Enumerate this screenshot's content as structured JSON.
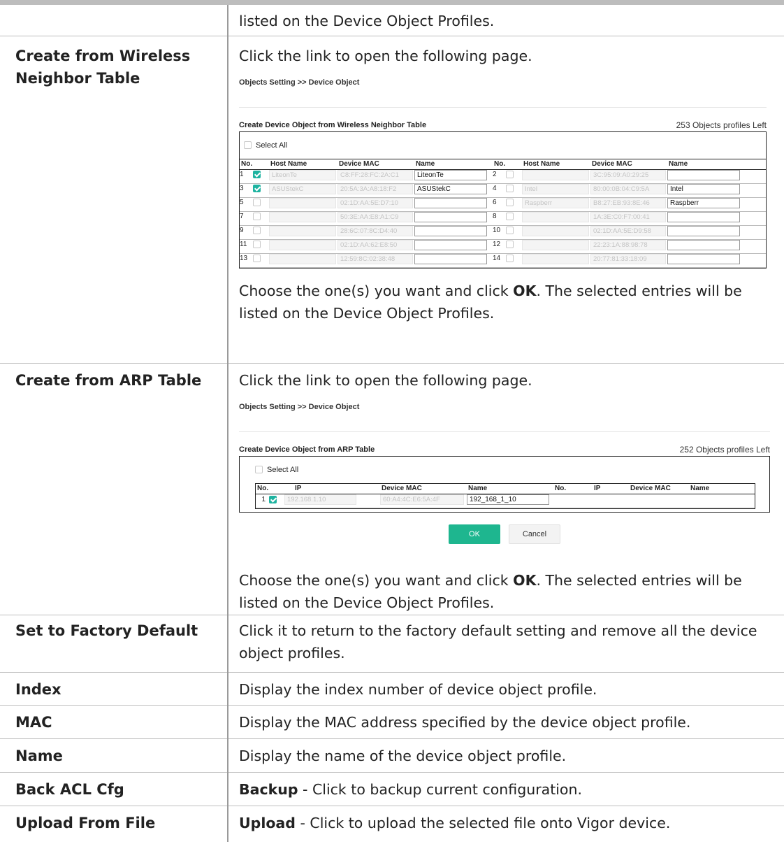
{
  "rows": [
    {
      "term": "",
      "desc": "listed on the Device Object Profiles."
    },
    {
      "term": "Create from Wireless Neighbor Table",
      "desc_intro": "Click the link to open the following page.",
      "desc_outro_pre": "Choose the one(s) you want and click ",
      "desc_outro_bold": "OK",
      "desc_outro_post": ". The selected entries will be listed on the Device Object Profiles."
    },
    {
      "term": "Create from ARP Table",
      "desc_intro": "Click the link to open the following page.",
      "desc_outro_pre": "Choose the one(s) you want and click ",
      "desc_outro_bold": "OK",
      "desc_outro_post": ". The selected entries will be listed on the Device Object Profiles."
    },
    {
      "term": "Set to Factory Default",
      "desc": "Click it to return to the factory default setting and remove all the device object profiles."
    },
    {
      "term": "Index",
      "desc": "Display the index number of device object profile."
    },
    {
      "term": "MAC",
      "desc": "Display the MAC address specified by the device object profile."
    },
    {
      "term": "Name",
      "desc": "Display the name of the device object profile."
    },
    {
      "term": "Back ACL Cfg",
      "desc_bold": "Backup",
      "desc": " - Click to backup current configuration."
    },
    {
      "term": "Upload From File",
      "desc_bold": "Upload",
      "desc": " - Click to upload the selected file onto Vigor device."
    }
  ],
  "wireless_panel": {
    "breadcrumb": "Objects Setting >> Device Object",
    "title": "Create Device Object from Wireless Neighbor Table",
    "profiles_left": "253 Objects profiles Left",
    "select_all": "Select All",
    "headers": [
      "No.",
      "Host Name",
      "Device MAC",
      "Name",
      "No.",
      "Host Name",
      "Device MAC",
      "Name"
    ],
    "entries": [
      {
        "no": "1",
        "checked": true,
        "host": "LiteonTe",
        "mac": "C8:FF:28:FC:2A:C1",
        "name": "LiteonTe"
      },
      {
        "no": "2",
        "checked": false,
        "host": "",
        "mac": "3C:95:09:A0:29:25",
        "name": ""
      },
      {
        "no": "3",
        "checked": true,
        "host": "ASUStekC",
        "mac": "20:5A:3A:A8:18:F2",
        "name": "ASUStekC"
      },
      {
        "no": "4",
        "checked": false,
        "host": "Intel",
        "mac": "80:00:0B:04:C9:5A",
        "name": "Intel"
      },
      {
        "no": "5",
        "checked": false,
        "host": "",
        "mac": "02:1D:AA:5E:D7:10",
        "name": ""
      },
      {
        "no": "6",
        "checked": false,
        "host": "Raspberr",
        "mac": "B8:27:EB:93:8E:46",
        "name": "Raspberr"
      },
      {
        "no": "7",
        "checked": false,
        "host": "",
        "mac": "50:3E:AA:E8:A1:C9",
        "name": ""
      },
      {
        "no": "8",
        "checked": false,
        "host": "",
        "mac": "1A:3E:C0:F7:00:41",
        "name": ""
      },
      {
        "no": "9",
        "checked": false,
        "host": "",
        "mac": "28:6C:07:8C:D4:40",
        "name": ""
      },
      {
        "no": "10",
        "checked": false,
        "host": "",
        "mac": "02:1D:AA:5E:D9:58",
        "name": ""
      },
      {
        "no": "11",
        "checked": false,
        "host": "",
        "mac": "02:1D:AA:62:E8:50",
        "name": ""
      },
      {
        "no": "12",
        "checked": false,
        "host": "",
        "mac": "22:23:1A:88:98:78",
        "name": ""
      },
      {
        "no": "13",
        "checked": false,
        "host": "",
        "mac": "12:59:8C:02:38:48",
        "name": ""
      },
      {
        "no": "14",
        "checked": false,
        "host": "",
        "mac": "20:77:81:33:18:09",
        "name": ""
      }
    ]
  },
  "arp_panel": {
    "breadcrumb": "Objects Setting >> Device Object",
    "title": "Create Device Object from ARP Table",
    "profiles_left": "252 Objects profiles Left",
    "select_all": "Select All",
    "headers": [
      "No.",
      "IP",
      "Device MAC",
      "Name",
      "No.",
      "IP",
      "Device MAC",
      "Name"
    ],
    "entries": [
      {
        "no": "1",
        "checked": true,
        "ip": "192.168.1.10",
        "mac": "60:A4:4C:E6:5A:4F",
        "name": "192_168_1_10"
      }
    ],
    "ok_label": "OK",
    "cancel_label": "Cancel"
  }
}
